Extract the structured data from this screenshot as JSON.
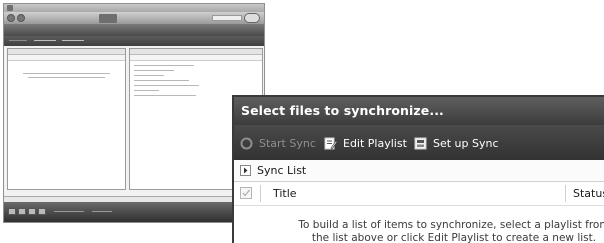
{
  "zoomed": {
    "header_title": "Select files to synchronize...",
    "toolbar": {
      "start_sync": "Start Sync",
      "edit_playlist": "Edit Playlist",
      "set_up_sync": "Set up Sync"
    },
    "sync_list_label": "Sync List",
    "columns": {
      "title": "Title",
      "status": "Status"
    },
    "empty_message_line1": "To build a list of items to synchronize, select a playlist from",
    "empty_message_line2": "the list above or click Edit Playlist to create a new list."
  },
  "icons": {
    "start_sync": "sync-arrows-icon",
    "edit_playlist": "edit-playlist-icon",
    "set_up_sync": "setup-sync-icon",
    "sync_list": "dropdown-arrow-icon",
    "select_all": "checkbox-icon"
  },
  "colors": {
    "header_bg": "#4d4d4d",
    "toolbar_bg": "#3d3d3d",
    "disabled_text": "#8f8f8f"
  }
}
